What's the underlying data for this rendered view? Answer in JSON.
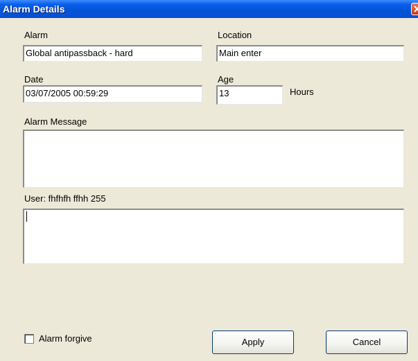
{
  "window": {
    "title": "Alarm Details"
  },
  "form": {
    "alarm_label": "Alarm",
    "alarm_value": "Global antipassback - hard",
    "location_label": "Location",
    "location_value": "Main enter",
    "date_label": "Date",
    "date_value": "03/07/2005 00:59:29",
    "age_label": "Age",
    "age_value": "13",
    "age_unit": "Hours",
    "message_label": "Alarm Message",
    "message_value": "",
    "user_label": "User: fhfhfh ffhh 255",
    "user_value": "",
    "forgive_label": "Alarm forgive",
    "forgive_checked": false
  },
  "buttons": {
    "apply": "Apply",
    "cancel": "Cancel"
  },
  "colors": {
    "titlebar": "#0353d9",
    "dialog": "#ece9d8",
    "close": "#c4381a"
  }
}
